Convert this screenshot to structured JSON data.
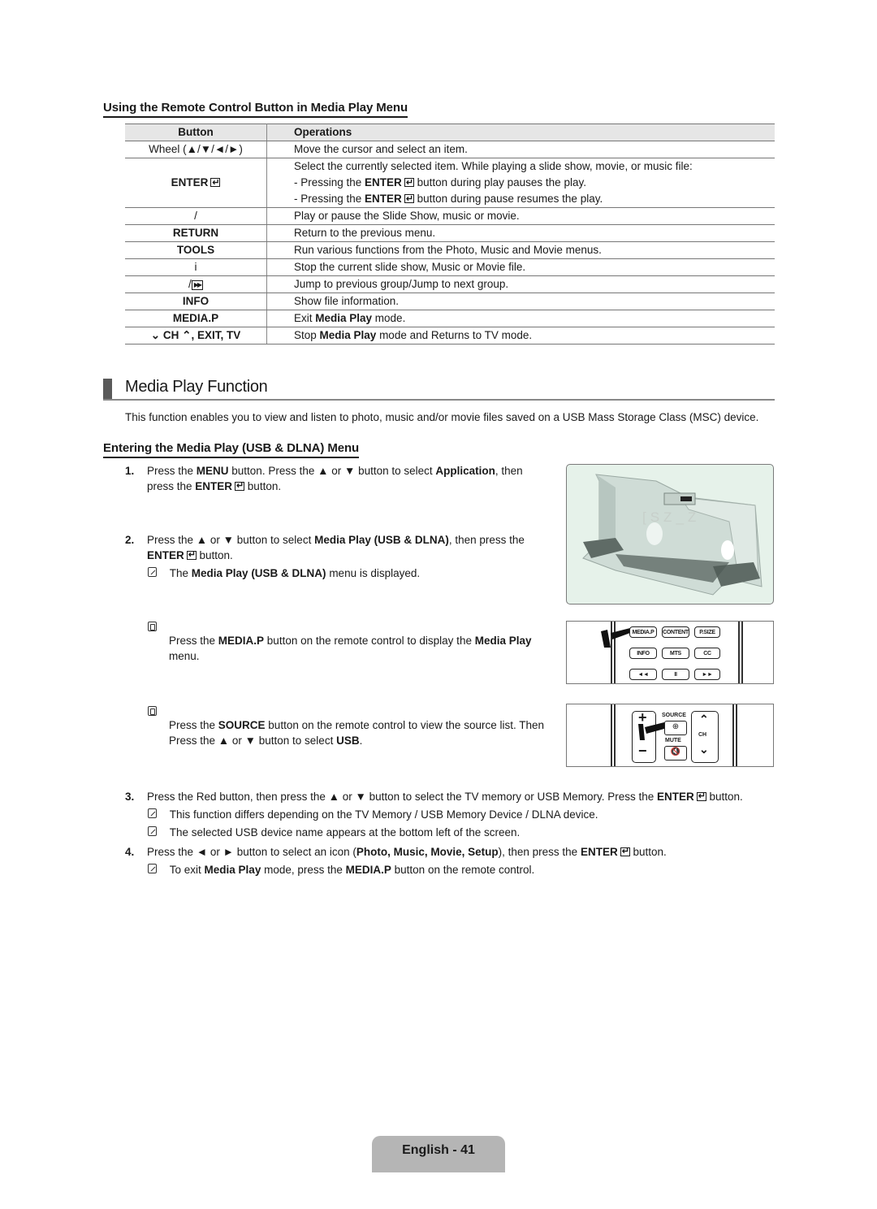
{
  "remote_section": {
    "heading": "Using the Remote Control Button in Media Play Menu",
    "table": {
      "headers": [
        "Button",
        "Operations"
      ],
      "rows": [
        {
          "button": "Wheel (▲/▼/◄/►)",
          "ops": [
            "Move the cursor and select an item."
          ]
        },
        {
          "button": "ENTER",
          "button_icon": "enter-icon",
          "ops": [
            "Select the currently selected item. While playing a slide show, movie, or music file:",
            "- Pressing the ENTER button during play pauses the play.",
            "- Pressing the ENTER button during pause resumes the play."
          ]
        },
        {
          "button": "/",
          "ops": [
            "Play or pause the Slide Show, music or movie."
          ]
        },
        {
          "button": "RETURN",
          "ops": [
            "Return to the previous menu."
          ]
        },
        {
          "button": "TOOLS",
          "ops": [
            "Run various functions from the Photo, Music and Movie menus."
          ]
        },
        {
          "button": "i",
          "ops": [
            "Stop the current slide show, Music or Movie file."
          ]
        },
        {
          "button": "/",
          "button_icon": "fast-forward-icon",
          "ops": [
            "Jump to previous group/Jump to next group."
          ]
        },
        {
          "button": "INFO",
          "ops": [
            "Show file information."
          ]
        },
        {
          "button": "MEDIA.P",
          "ops": [
            "Exit Media Play mode."
          ]
        },
        {
          "button": "CH , EXIT, TV",
          "ops": [
            "Stop Media Play mode and Returns to TV mode."
          ]
        }
      ],
      "enter_row_parts": {
        "pressing": "- Pressing the ",
        "enter": "ENTER",
        "during_play": " button during play pauses the play.",
        "during_pause": " button during pause resumes the play."
      },
      "mediap_parts": {
        "pre": "Exit ",
        "bold": "Media Play",
        "post": " mode."
      },
      "ch_parts": {
        "pre": "Stop ",
        "bold": "Media Play",
        "post": " mode and Returns to TV mode.",
        "ch": "CH",
        "rest": ", EXIT, TV"
      }
    }
  },
  "function_section": {
    "title": "Media Play Function",
    "intro": "This function enables you to view and listen to photo, music and/or movie files saved on a USB Mass Storage Class (MSC) device.",
    "subheading": "Entering the Media Play (USB & DLNA) Menu",
    "steps": [
      {
        "num": "1.",
        "parts": [
          "Press the ",
          "MENU",
          " button. Press the ▲ or ▼ button to select ",
          "Application",
          ", then"
        ],
        "line2": [
          "press the ",
          "ENTER",
          " button."
        ]
      },
      {
        "num": "2.",
        "parts": [
          "Press the ▲ or ▼ button to select ",
          "Media Play (USB & DLNA)",
          ", then press the"
        ],
        "line2": [
          "ENTER",
          " button."
        ],
        "note": [
          "The ",
          "Media Play (USB & DLNA)",
          " menu is displayed."
        ]
      },
      {
        "num": "3.",
        "parts": [
          "Press the Red button, then press the ▲ or ▼ button to select the TV memory or USB Memory. Press the ",
          "ENTER",
          " button."
        ],
        "notes": [
          "This function differs depending on the TV Memory / USB Memory Device / DLNA device.",
          "The selected USB device name appears at the bottom left of the screen."
        ]
      },
      {
        "num": "4.",
        "parts": [
          "Press the ◄ or ► button to select an icon (",
          "Photo, Music, Movie, Setup",
          "), then press the ",
          "ENTER",
          " button."
        ],
        "note": [
          "To exit ",
          "Media Play",
          " mode, press the ",
          "MEDIA.P",
          " button on the remote control."
        ]
      }
    ],
    "tips": [
      {
        "parts": [
          "Press the ",
          "MEDIA.P",
          " button on the remote control to display the ",
          "Media Play"
        ],
        "line2": "menu."
      },
      {
        "parts": [
          "Press the ",
          "SOURCE",
          " button on the remote control to view the source list. Then"
        ],
        "line2": [
          "Press the ▲ or ▼ button to select ",
          "USB",
          "."
        ]
      }
    ],
    "remote1_buttons": [
      "MEDIA.P",
      "CONTENT",
      "P.SIZE",
      "INFO",
      "MTS",
      "CC",
      "◄◄",
      "II",
      "►►"
    ],
    "remote2_labels": {
      "source": "SOURCE",
      "mute": "MUTE",
      "ch": "CH",
      "plus": "+",
      "minus": "−"
    }
  },
  "footer": {
    "page_label": "English - 41"
  }
}
